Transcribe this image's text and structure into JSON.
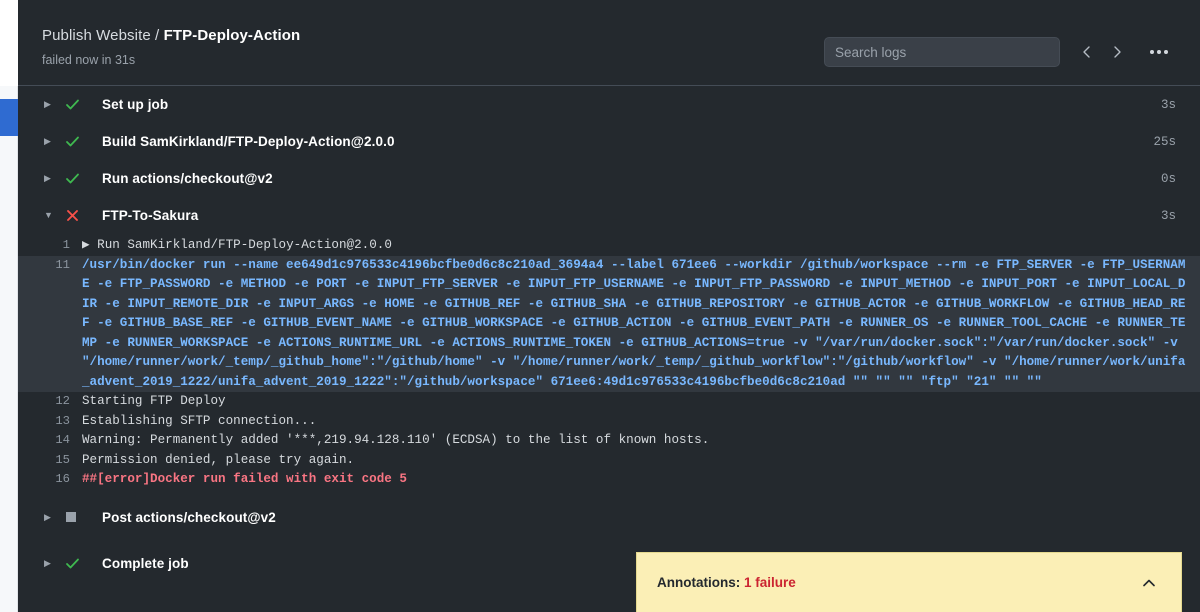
{
  "header": {
    "workflow": "Publish Website",
    "separator": " / ",
    "job": "FTP-Deploy-Action",
    "status_line": "failed now in 31s",
    "search_placeholder": "Search logs",
    "search_value": "",
    "prev_label": "‹",
    "next_label": "›",
    "kebab_name": "more-options"
  },
  "steps": [
    {
      "label": "Set up job",
      "time": "3s",
      "status": "success",
      "caret": "▶",
      "expanded": false
    },
    {
      "label": "Build SamKirkland/FTP-Deploy-Action@2.0.0",
      "time": "25s",
      "status": "success",
      "caret": "▶",
      "expanded": false
    },
    {
      "label": "Run actions/checkout@v2",
      "time": "0s",
      "status": "success",
      "caret": "▶",
      "expanded": false
    },
    {
      "label": "FTP-To-Sakura",
      "time": "3s",
      "status": "failure",
      "caret": "▼",
      "expanded": true
    }
  ],
  "bottom_steps": [
    {
      "label": "Post actions/checkout@v2",
      "time": "",
      "status": "skipped",
      "caret": "▶"
    },
    {
      "label": "Complete job",
      "time": "",
      "status": "success",
      "caret": "▶"
    }
  ],
  "log_lines": [
    {
      "num": "1",
      "text": "▶ Run SamKirkland/FTP-Deploy-Action@2.0.0",
      "style": "plain",
      "highlight": false
    },
    {
      "num": "11",
      "text": "/usr/bin/docker run --name ee649d1c976533c4196bcfbe0d6c8c210ad_3694a4 --label 671ee6 --workdir /github/workspace --rm -e FTP_SERVER -e FTP_USERNAME -e FTP_PASSWORD -e METHOD -e PORT -e INPUT_FTP_SERVER -e INPUT_FTP_USERNAME -e INPUT_FTP_PASSWORD -e INPUT_METHOD -e INPUT_PORT -e INPUT_LOCAL_DIR -e INPUT_REMOTE_DIR -e INPUT_ARGS -e HOME -e GITHUB_REF -e GITHUB_SHA -e GITHUB_REPOSITORY -e GITHUB_ACTOR -e GITHUB_WORKFLOW -e GITHUB_HEAD_REF -e GITHUB_BASE_REF -e GITHUB_EVENT_NAME -e GITHUB_WORKSPACE -e GITHUB_ACTION -e GITHUB_EVENT_PATH -e RUNNER_OS -e RUNNER_TOOL_CACHE -e RUNNER_TEMP -e RUNNER_WORKSPACE -e ACTIONS_RUNTIME_URL -e ACTIONS_RUNTIME_TOKEN -e GITHUB_ACTIONS=true -v \"/var/run/docker.sock\":\"/var/run/docker.sock\" -v \"/home/runner/work/_temp/_github_home\":\"/github/home\" -v \"/home/runner/work/_temp/_github_workflow\":\"/github/workflow\" -v \"/home/runner/work/unifa_advent_2019_1222/unifa_advent_2019_1222\":\"/github/workspace\" 671ee6:49d1c976533c4196bcfbe0d6c8c210ad \"\" \"\" \"\" \"ftp\" \"21\" \"\" \"\"",
      "style": "cmd",
      "highlight": true
    },
    {
      "num": "12",
      "text": "Starting FTP Deploy",
      "style": "plain",
      "highlight": false
    },
    {
      "num": "13",
      "text": "Establishing SFTP connection...",
      "style": "plain",
      "highlight": false
    },
    {
      "num": "14",
      "text": "Warning: Permanently added '***,219.94.128.110' (ECDSA) to the list of known hosts.",
      "style": "plain",
      "highlight": false
    },
    {
      "num": "15",
      "text": "Permission denied, please try again.",
      "style": "plain",
      "highlight": false
    },
    {
      "num": "16",
      "text": "##[error]Docker run failed with exit code 5",
      "style": "err",
      "highlight": false
    }
  ],
  "annotations": {
    "label": "Annotations: ",
    "failure_text": "1 failure",
    "chevron": "∧"
  },
  "colors": {
    "panel_bg": "#24292e",
    "highlight_bg": "#32383f",
    "success": "#3fb950",
    "failure": "#f85149",
    "skipped": "#9aa2ab",
    "command_text": "#79b8ff",
    "error_text": "#f97583",
    "annotation_bg": "#fbefb6",
    "annotation_fail": "#cb2431",
    "rail_active": "#2f6bd1"
  }
}
